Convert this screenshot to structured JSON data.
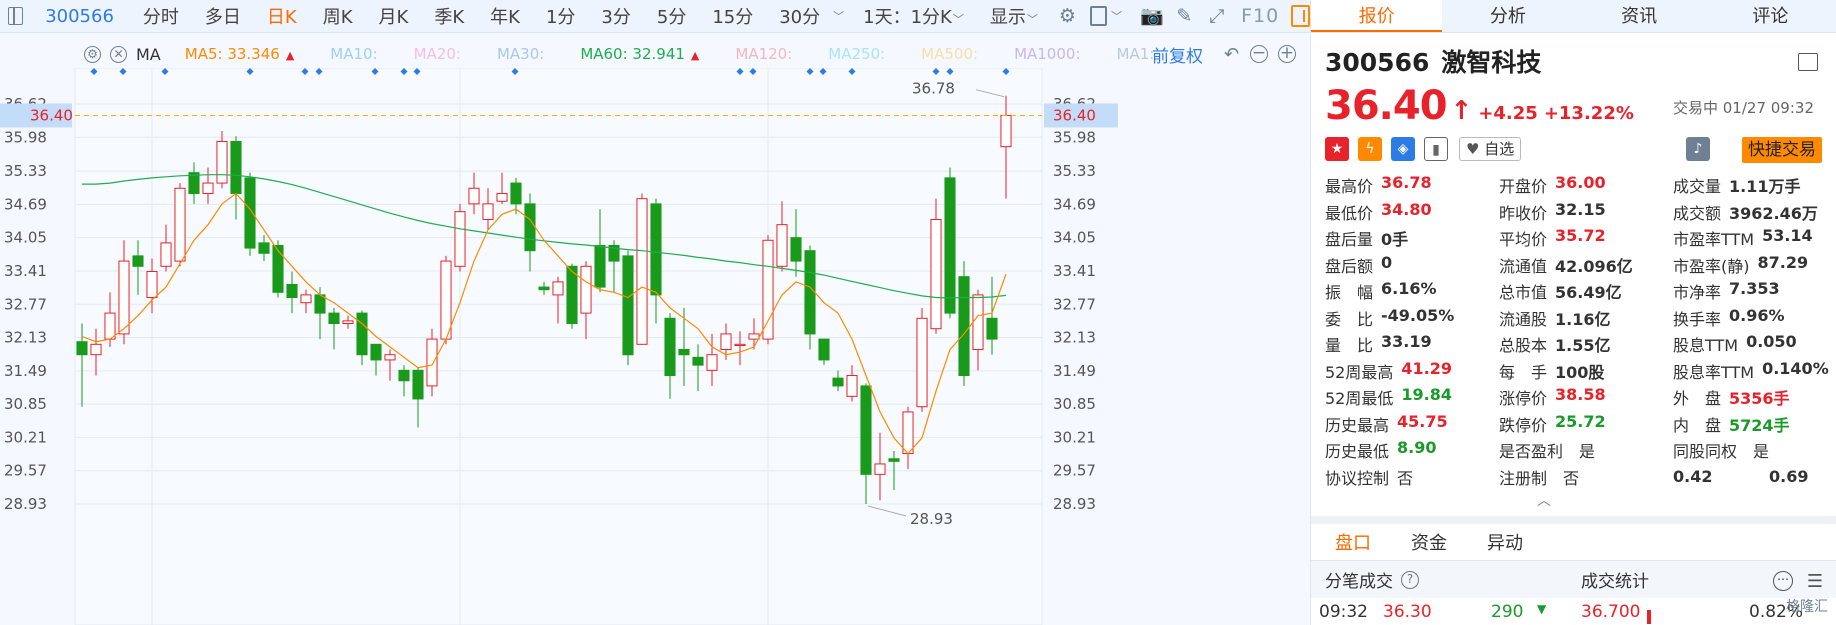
{
  "toolbar": {
    "stock_code": "300566",
    "periods": [
      {
        "label": "分时",
        "active": false
      },
      {
        "label": "多日",
        "active": false
      },
      {
        "label": "日K",
        "active": true
      },
      {
        "label": "周K",
        "active": false
      },
      {
        "label": "月K",
        "active": false
      },
      {
        "label": "季K",
        "active": false
      },
      {
        "label": "年K",
        "active": false
      },
      {
        "label": "1分",
        "active": false
      },
      {
        "label": "3分",
        "active": false
      },
      {
        "label": "5分",
        "active": false
      },
      {
        "label": "15分",
        "active": false
      },
      {
        "label": "30分",
        "active": false
      }
    ],
    "multi_period": "1天：1分K",
    "display": "显示",
    "f10": "F10"
  },
  "ma_bar": {
    "label": "MA",
    "items": [
      {
        "text": "MA5: 33.346",
        "color": "#ff8a00",
        "arrow": true
      },
      {
        "text": "MA10:",
        "color": "#9fcff5",
        "arrow": false
      },
      {
        "text": "MA20:",
        "color": "#f3bfe6",
        "arrow": false
      },
      {
        "text": "MA30:",
        "color": "#a9c8ea",
        "arrow": false
      },
      {
        "text": "MA60: 32.941",
        "color": "#1fae4e",
        "arrow": true
      },
      {
        "text": "MA120:",
        "color": "#f6b6c0",
        "arrow": false
      },
      {
        "text": "MA250:",
        "color": "#a6e4f8",
        "arrow": false
      },
      {
        "text": "MA500:",
        "color": "#f7dfa7",
        "arrow": false
      },
      {
        "text": "MA1000:",
        "color": "#c6b8f0",
        "arrow": false
      },
      {
        "text": "MA1:",
        "color": "#b7c9dd",
        "arrow": false
      }
    ],
    "fuquan": "前复权"
  },
  "chart_data": {
    "type": "candlestick",
    "title": "",
    "y_ticks": [
      36.62,
      35.98,
      35.33,
      34.69,
      34.05,
      33.41,
      32.77,
      32.13,
      31.49,
      30.85,
      30.21,
      29.57,
      28.93
    ],
    "ylim": [
      28.93,
      36.62
    ],
    "current_price": 36.4,
    "max_label": "36.78",
    "min_label": "28.93",
    "colors": {
      "up": "#e8222a",
      "down": "#1a9a1a",
      "ma5": "#ff8a00",
      "ma60": "#1fae4e"
    },
    "candles": [
      {
        "o": 32.05,
        "c": 31.8,
        "h": 32.4,
        "l": 30.8
      },
      {
        "o": 31.8,
        "c": 32.0,
        "h": 32.3,
        "l": 31.4
      },
      {
        "o": 32.1,
        "c": 32.6,
        "h": 33.0,
        "l": 31.95
      },
      {
        "o": 32.2,
        "c": 33.6,
        "h": 34.0,
        "l": 32.0
      },
      {
        "o": 33.7,
        "c": 33.5,
        "h": 34.0,
        "l": 32.95
      },
      {
        "o": 32.9,
        "c": 33.4,
        "h": 33.65,
        "l": 32.6
      },
      {
        "o": 33.5,
        "c": 33.95,
        "h": 34.3,
        "l": 33.4
      },
      {
        "o": 33.6,
        "c": 35.0,
        "h": 35.1,
        "l": 33.5
      },
      {
        "o": 35.3,
        "c": 34.9,
        "h": 35.5,
        "l": 34.7
      },
      {
        "o": 34.9,
        "c": 35.1,
        "h": 35.4,
        "l": 34.7
      },
      {
        "o": 35.1,
        "c": 35.9,
        "h": 36.1,
        "l": 35.0
      },
      {
        "o": 35.9,
        "c": 34.9,
        "h": 36.0,
        "l": 34.4
      },
      {
        "o": 35.2,
        "c": 33.85,
        "h": 35.3,
        "l": 33.7
      },
      {
        "o": 33.95,
        "c": 33.75,
        "h": 34.1,
        "l": 33.6
      },
      {
        "o": 33.9,
        "c": 33.0,
        "h": 34.0,
        "l": 32.9
      },
      {
        "o": 33.15,
        "c": 32.9,
        "h": 33.4,
        "l": 32.6
      },
      {
        "o": 32.8,
        "c": 32.95,
        "h": 33.05,
        "l": 32.6
      },
      {
        "o": 32.95,
        "c": 32.6,
        "h": 33.1,
        "l": 32.1
      },
      {
        "o": 32.6,
        "c": 32.4,
        "h": 32.7,
        "l": 31.9
      },
      {
        "o": 32.4,
        "c": 32.45,
        "h": 32.55,
        "l": 32.3
      },
      {
        "o": 32.6,
        "c": 31.8,
        "h": 32.65,
        "l": 31.6
      },
      {
        "o": 32.0,
        "c": 31.7,
        "h": 32.0,
        "l": 31.4
      },
      {
        "o": 31.7,
        "c": 31.8,
        "h": 31.9,
        "l": 31.3
      },
      {
        "o": 31.5,
        "c": 31.3,
        "h": 31.6,
        "l": 31.0
      },
      {
        "o": 31.5,
        "c": 30.95,
        "h": 31.55,
        "l": 30.4
      },
      {
        "o": 31.2,
        "c": 32.1,
        "h": 32.3,
        "l": 31.0
      },
      {
        "o": 32.1,
        "c": 33.6,
        "h": 33.7,
        "l": 32.0
      },
      {
        "o": 33.5,
        "c": 34.55,
        "h": 34.7,
        "l": 33.4
      },
      {
        "o": 34.7,
        "c": 35.0,
        "h": 35.3,
        "l": 34.5
      },
      {
        "o": 34.4,
        "c": 34.7,
        "h": 35.0,
        "l": 34.2
      },
      {
        "o": 34.75,
        "c": 34.9,
        "h": 35.3,
        "l": 34.7
      },
      {
        "o": 35.1,
        "c": 34.7,
        "h": 35.2,
        "l": 34.5
      },
      {
        "o": 34.7,
        "c": 33.8,
        "h": 34.9,
        "l": 33.4
      },
      {
        "o": 33.1,
        "c": 33.05,
        "h": 33.2,
        "l": 32.95
      },
      {
        "o": 32.95,
        "c": 33.2,
        "h": 33.3,
        "l": 32.4
      },
      {
        "o": 33.5,
        "c": 32.4,
        "h": 33.55,
        "l": 32.3
      },
      {
        "o": 32.6,
        "c": 33.5,
        "h": 33.6,
        "l": 32.1
      },
      {
        "o": 33.9,
        "c": 33.1,
        "h": 34.6,
        "l": 33.0
      },
      {
        "o": 33.9,
        "c": 33.6,
        "h": 34.0,
        "l": 33.0
      },
      {
        "o": 33.7,
        "c": 31.8,
        "h": 33.8,
        "l": 31.6
      },
      {
        "o": 32.0,
        "c": 34.8,
        "h": 34.9,
        "l": 32.0
      },
      {
        "o": 34.7,
        "c": 32.95,
        "h": 34.8,
        "l": 32.4
      },
      {
        "o": 32.5,
        "c": 31.4,
        "h": 32.6,
        "l": 30.95
      },
      {
        "o": 31.9,
        "c": 31.8,
        "h": 32.7,
        "l": 31.2
      },
      {
        "o": 31.75,
        "c": 31.6,
        "h": 32.0,
        "l": 31.1
      },
      {
        "o": 31.5,
        "c": 31.8,
        "h": 32.2,
        "l": 31.2
      },
      {
        "o": 31.9,
        "c": 32.2,
        "h": 32.4,
        "l": 31.7
      },
      {
        "o": 32.0,
        "c": 32.0,
        "h": 32.25,
        "l": 31.6
      },
      {
        "o": 32.1,
        "c": 32.2,
        "h": 32.5,
        "l": 31.9
      },
      {
        "o": 32.1,
        "c": 34.0,
        "h": 34.1,
        "l": 32.0
      },
      {
        "o": 33.5,
        "c": 34.3,
        "h": 34.75,
        "l": 33.4
      },
      {
        "o": 34.05,
        "c": 33.6,
        "h": 34.6,
        "l": 33.3
      },
      {
        "o": 33.8,
        "c": 32.2,
        "h": 33.9,
        "l": 31.9
      },
      {
        "o": 32.1,
        "c": 31.7,
        "h": 32.1,
        "l": 31.6
      },
      {
        "o": 31.35,
        "c": 31.2,
        "h": 31.5,
        "l": 31.1
      },
      {
        "o": 31.0,
        "c": 31.4,
        "h": 31.6,
        "l": 30.9
      },
      {
        "o": 31.2,
        "c": 29.5,
        "h": 31.25,
        "l": 28.93
      },
      {
        "o": 29.5,
        "c": 29.7,
        "h": 30.3,
        "l": 29.0
      },
      {
        "o": 29.8,
        "c": 29.75,
        "h": 29.95,
        "l": 29.2
      },
      {
        "o": 29.9,
        "c": 30.7,
        "h": 30.8,
        "l": 29.6
      },
      {
        "o": 30.8,
        "c": 32.5,
        "h": 32.7,
        "l": 30.7
      },
      {
        "o": 32.3,
        "c": 34.4,
        "h": 34.8,
        "l": 32.2
      },
      {
        "o": 35.2,
        "c": 32.6,
        "h": 35.4,
        "l": 32.5
      },
      {
        "o": 33.3,
        "c": 31.4,
        "h": 33.6,
        "l": 31.2
      },
      {
        "o": 31.9,
        "c": 32.95,
        "h": 33.05,
        "l": 31.5
      },
      {
        "o": 32.5,
        "c": 32.1,
        "h": 33.3,
        "l": 31.8
      },
      {
        "o": 35.8,
        "c": 36.4,
        "h": 36.78,
        "l": 34.8
      }
    ],
    "ma5": [
      32.15,
      32.05,
      32.1,
      32.3,
      32.55,
      32.85,
      33.1,
      33.55,
      34.0,
      34.3,
      34.7,
      34.9,
      34.6,
      34.2,
      33.8,
      33.5,
      33.2,
      32.95,
      32.8,
      32.6,
      32.4,
      32.15,
      31.95,
      31.75,
      31.55,
      31.6,
      32.1,
      32.8,
      33.6,
      34.2,
      34.5,
      34.6,
      34.4,
      34.0,
      33.7,
      33.4,
      33.2,
      33.05,
      33.0,
      32.9,
      33.1,
      33.0,
      32.7,
      32.5,
      32.3,
      31.95,
      31.8,
      31.85,
      31.95,
      32.45,
      32.95,
      33.2,
      33.1,
      32.8,
      32.6,
      32.1,
      31.4,
      30.7,
      30.2,
      29.9,
      30.2,
      31.1,
      31.9,
      32.2,
      32.55,
      32.6,
      33.35
    ],
    "ma60": [
      35.08,
      35.08,
      35.1,
      35.14,
      35.17,
      35.2,
      35.22,
      35.24,
      35.25,
      35.26,
      35.26,
      35.25,
      35.22,
      35.18,
      35.13,
      35.07,
      35.0,
      34.92,
      34.84,
      34.76,
      34.68,
      34.6,
      34.52,
      34.45,
      34.38,
      34.32,
      34.27,
      34.22,
      34.18,
      34.14,
      34.1,
      34.06,
      34.02,
      33.99,
      33.96,
      33.93,
      33.91,
      33.88,
      33.85,
      33.82,
      33.8,
      33.77,
      33.74,
      33.71,
      33.67,
      33.64,
      33.6,
      33.57,
      33.53,
      33.5,
      33.46,
      33.42,
      33.38,
      33.33,
      33.27,
      33.21,
      33.15,
      33.09,
      33.03,
      32.98,
      32.93,
      32.9,
      32.89,
      32.9,
      32.9,
      32.91,
      32.94
    ]
  },
  "panel": {
    "tabs": [
      {
        "label": "报价",
        "active": true
      },
      {
        "label": "分析",
        "active": false
      },
      {
        "label": "资讯",
        "active": false
      },
      {
        "label": "评论",
        "active": false
      }
    ],
    "stock_code": "300566",
    "stock_name": "激智科技",
    "price": "36.40",
    "change": "+4.25",
    "change_pct": "+13.22%",
    "trade_state": "交易中 01/27 09:32",
    "watch_label": "自选",
    "quick_trade": "快捷交易",
    "quote_rows": [
      [
        {
          "l": "最高价",
          "v": "36.78",
          "c": "red"
        },
        {
          "l": "开盘价",
          "v": "36.00",
          "c": "red"
        },
        {
          "l": "成交量",
          "v": "1.11万手",
          "c": ""
        }
      ],
      [
        {
          "l": "最低价",
          "v": "34.80",
          "c": "red"
        },
        {
          "l": "昨收价",
          "v": "32.15",
          "c": ""
        },
        {
          "l": "成交额",
          "v": "3962.46万",
          "c": ""
        }
      ],
      [
        {
          "l": "盘后量",
          "v": "0手",
          "c": ""
        },
        {
          "l": "平均价",
          "v": "35.72",
          "c": "red"
        },
        {
          "l": "市盈率TTM",
          "v": "53.14",
          "c": ""
        }
      ],
      [
        {
          "l": "盘后额",
          "v": "0",
          "c": ""
        },
        {
          "l": "流通值",
          "v": "42.096亿",
          "c": ""
        },
        {
          "l": "市盈率(静)",
          "v": "87.29",
          "c": ""
        }
      ],
      [
        {
          "l": "振　幅",
          "v": "6.16%",
          "c": ""
        },
        {
          "l": "总市值",
          "v": "56.49亿",
          "c": ""
        },
        {
          "l": "市净率",
          "v": "7.353",
          "c": ""
        }
      ],
      [
        {
          "l": "委　比",
          "v": "-49.05%",
          "c": ""
        },
        {
          "l": "流通股",
          "v": "1.16亿",
          "c": ""
        },
        {
          "l": "换手率",
          "v": "0.96%",
          "c": ""
        }
      ],
      [
        {
          "l": "量　比",
          "v": "33.19",
          "c": ""
        },
        {
          "l": "总股本",
          "v": "1.55亿",
          "c": ""
        },
        {
          "l": "股息TTM",
          "v": "0.050",
          "c": ""
        }
      ],
      [
        {
          "l": "52周最高",
          "v": "41.29",
          "c": "red"
        },
        {
          "l": "每　手",
          "v": "100股",
          "c": ""
        },
        {
          "l": "股息率TTM",
          "v": "0.140%",
          "c": ""
        }
      ],
      [
        {
          "l": "52周最低",
          "v": "19.84",
          "c": "green"
        },
        {
          "l": "涨停价",
          "v": "38.58",
          "c": "red"
        },
        {
          "l": "外　盘",
          "v": "5356手",
          "c": "red"
        }
      ],
      [
        {
          "l": "历史最高",
          "v": "45.75",
          "c": "red"
        },
        {
          "l": "跌停价",
          "v": "25.72",
          "c": "green"
        },
        {
          "l": "内　盘",
          "v": "5724手",
          "c": "green"
        }
      ],
      [
        {
          "l": "历史最低",
          "v": "8.90",
          "c": "green"
        },
        {
          "l": "是否盈利",
          "v": "是",
          "c": "plain"
        },
        {
          "l": "同股同权",
          "v": "是",
          "c": "plain"
        }
      ],
      [
        {
          "l": "协议控制",
          "v": "否",
          "c": "plain"
        },
        {
          "l": "注册制",
          "v": "否",
          "c": "plain"
        },
        {
          "l": "0.42",
          "v": "0.69",
          "c": "pair"
        }
      ]
    ],
    "sub_tabs": [
      {
        "label": "盘口",
        "active": true
      },
      {
        "label": "资金",
        "active": false
      },
      {
        "label": "异动",
        "active": false
      }
    ],
    "tick_label": "分笔成交",
    "stat_label": "成交统计",
    "trade_row": {
      "time": "09:32",
      "price": "36.30",
      "vol": "290",
      "stat_price": "36.700",
      "stat_pct": "0.82%"
    },
    "watermark": "格隆汇"
  }
}
